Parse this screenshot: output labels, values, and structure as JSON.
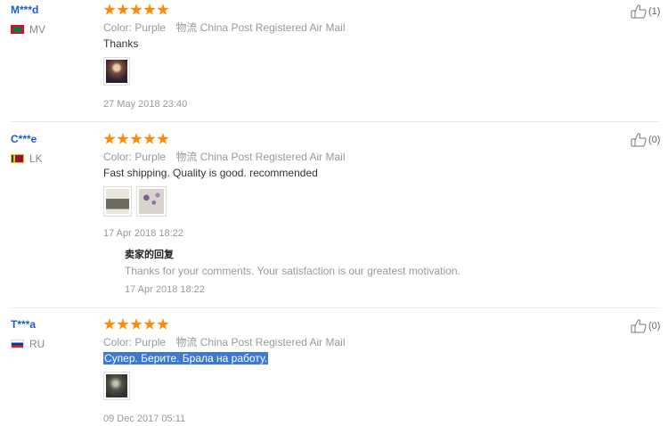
{
  "meta_labels": {
    "color_key": "Color:",
    "shipping_key": "物流"
  },
  "reviews": [
    {
      "user": "M***d",
      "country": "MV",
      "color": "Purple",
      "shipping": "China Post Registered Air Mail",
      "comment": "Thanks",
      "date": "27 May 2018 23:40",
      "helpful": "(1)",
      "rating": 5
    },
    {
      "user": "C***e",
      "country": "LK",
      "color": "Purple",
      "shipping": "China Post Registered Air Mail",
      "comment": "Fast shipping. Quality is good. recommended",
      "date": "17 Apr 2018 18:22",
      "helpful": "(0)",
      "rating": 5,
      "seller_reply": {
        "title": "卖家的回复",
        "text": "Thanks for your comments. Your satisfaction is our greatest motivation.",
        "date": "17 Apr 2018 18:22"
      }
    },
    {
      "user": "T***a",
      "country": "RU",
      "color": "Purple",
      "shipping": "China Post Registered Air Mail",
      "comment": "Супер. Берите. Брала на работу.",
      "date": "09 Dec 2017 05:11",
      "helpful": "(0)",
      "rating": 5
    }
  ],
  "colors": {
    "star": "#ff8a00",
    "username": "#1a5ec9",
    "selection": "#3a79d6"
  }
}
